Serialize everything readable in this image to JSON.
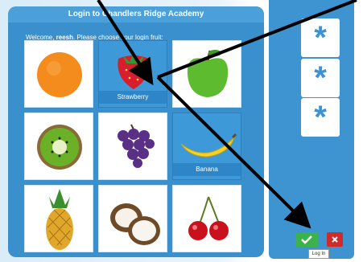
{
  "login": {
    "title": "Login to Chandlers Ridge Academy",
    "welcome_prefix": "Welcome,",
    "username": "reesh",
    "welcome_suffix": "Please choose your login fruit:"
  },
  "fruits": [
    {
      "name": "orange",
      "label": ""
    },
    {
      "name": "strawberry",
      "label": "Strawberry"
    },
    {
      "name": "apple",
      "label": ""
    },
    {
      "name": "kiwi",
      "label": ""
    },
    {
      "name": "grapes",
      "label": ""
    },
    {
      "name": "banana",
      "label": "Banana"
    },
    {
      "name": "pineapple",
      "label": ""
    },
    {
      "name": "coconut",
      "label": ""
    },
    {
      "name": "cherries",
      "label": ""
    }
  ],
  "password_slots": [
    "*",
    "*",
    "*"
  ],
  "buttons": {
    "login_tooltip": "Log In"
  },
  "colors": {
    "panel_blue": "#3a8fcd",
    "selected_blue": "#3e99d8",
    "ok_green": "#3bb34a",
    "cancel_red": "#d02b2b"
  }
}
